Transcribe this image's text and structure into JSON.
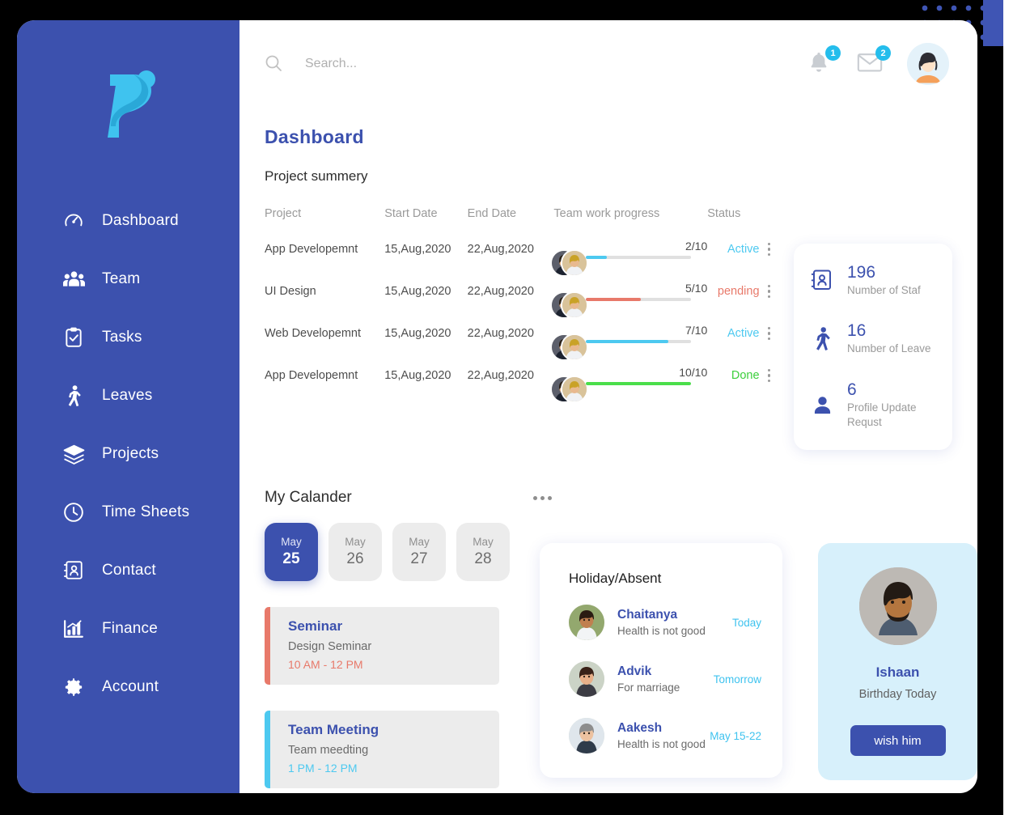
{
  "brand": {
    "logo_letter": "P",
    "accent_blue": "#3c51ae",
    "accent_cyan": "#3fc3ef"
  },
  "sidebar": {
    "items": [
      {
        "label": "Dashboard",
        "icon": "speedometer-icon"
      },
      {
        "label": "Team",
        "icon": "people-group-icon"
      },
      {
        "label": "Tasks",
        "icon": "clipboard-check-icon"
      },
      {
        "label": "Leaves",
        "icon": "walking-person-icon"
      },
      {
        "label": "Projects",
        "icon": "layers-icon"
      },
      {
        "label": "Time Sheets",
        "icon": "clock-icon"
      },
      {
        "label": "Contact",
        "icon": "contact-book-icon"
      },
      {
        "label": "Finance",
        "icon": "bar-chart-icon"
      },
      {
        "label": "Account",
        "icon": "gear-icon"
      }
    ]
  },
  "topbar": {
    "search_placeholder": "Search...",
    "search_value": "",
    "notification_badge": "1",
    "mail_badge": "2"
  },
  "page": {
    "title": "Dashboard",
    "section_title": "Project summery"
  },
  "table": {
    "headers": {
      "project": "Project",
      "start_date": "Start Date",
      "end_date": "End Date",
      "team": "Team",
      "progress": "work progress",
      "status": "Status"
    },
    "rows": [
      {
        "project": "App Developemnt",
        "start": "15,Aug,2020",
        "end": "22,Aug,2020",
        "progress_label": "2/10",
        "progress_pct": 20,
        "progress_color": "#4dc9f0",
        "status": "Active",
        "status_color": "#4dc9f0"
      },
      {
        "project": "UI Design",
        "start": "15,Aug,2020",
        "end": "22,Aug,2020",
        "progress_label": "5/10",
        "progress_pct": 52,
        "progress_color": "#e8796a",
        "status": "pending",
        "status_color": "#e8796a"
      },
      {
        "project": "Web Developemnt",
        "start": "15,Aug,2020",
        "end": "22,Aug,2020",
        "progress_label": "7/10",
        "progress_pct": 78,
        "progress_color": "#4dc9f0",
        "status": "Active",
        "status_color": "#4dc9f0"
      },
      {
        "project": "App Developemnt",
        "start": "15,Aug,2020",
        "end": "22,Aug,2020",
        "progress_label": "10/10",
        "progress_pct": 100,
        "progress_color": "#4ade4a",
        "status": "Done",
        "status_color": "#3ccf3c"
      }
    ]
  },
  "stats": [
    {
      "value": "196",
      "label": "Number of Staf",
      "icon": "contact-book-icon"
    },
    {
      "value": "16",
      "label": "Number of Leave",
      "icon": "walking-person-icon"
    },
    {
      "value": "6",
      "label": "Profile Update Requst",
      "icon": "user-icon"
    }
  ],
  "calendar": {
    "title": "My Calander",
    "dates": [
      {
        "month": "May",
        "day": "25",
        "selected": true
      },
      {
        "month": "May",
        "day": "26",
        "selected": false
      },
      {
        "month": "May",
        "day": "27",
        "selected": false
      },
      {
        "month": "May",
        "day": "28",
        "selected": false
      }
    ],
    "events": [
      {
        "title": "Seminar",
        "desc": "Design Seminar",
        "time": "10 AM - 12 PM",
        "color": "#e8796a"
      },
      {
        "title": "Team Meeting",
        "desc": "Team meedting",
        "time": "1 PM - 12 PM",
        "color": "#4dc9f0"
      }
    ]
  },
  "holiday": {
    "title": "Holiday/Absent",
    "rows": [
      {
        "name": "Chaitanya",
        "reason": "Health is not good",
        "when": "Today"
      },
      {
        "name": "Advik",
        "reason": "For marriage",
        "when": "Tomorrow"
      },
      {
        "name": "Aakesh",
        "reason": "Health is not good",
        "when": "May 15-22"
      }
    ]
  },
  "birthday": {
    "name": "Ishaan",
    "subtitle": "Birthday Today",
    "button": "wish him"
  }
}
